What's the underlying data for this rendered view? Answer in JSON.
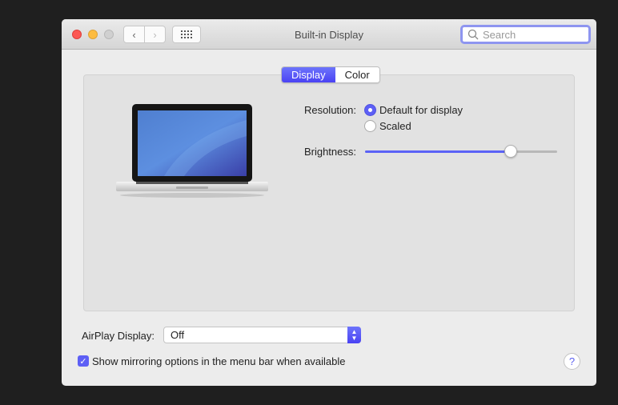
{
  "window": {
    "title": "Built-in Display",
    "search_placeholder": "Search"
  },
  "tabs": [
    {
      "label": "Display",
      "selected": true
    },
    {
      "label": "Color",
      "selected": false
    }
  ],
  "resolution": {
    "label": "Resolution:",
    "options": [
      {
        "label": "Default for display",
        "selected": true
      },
      {
        "label": "Scaled",
        "selected": false
      }
    ]
  },
  "brightness": {
    "label": "Brightness:",
    "value": 0.76
  },
  "airplay": {
    "label": "AirPlay Display:",
    "value": "Off"
  },
  "mirroring": {
    "label": "Show mirroring options in the menu bar when available",
    "checked": true
  },
  "help": {
    "label": "?"
  },
  "colors": {
    "accent": "#5d5ff5",
    "close": "#fc5753",
    "minimize": "#fdbc40"
  }
}
